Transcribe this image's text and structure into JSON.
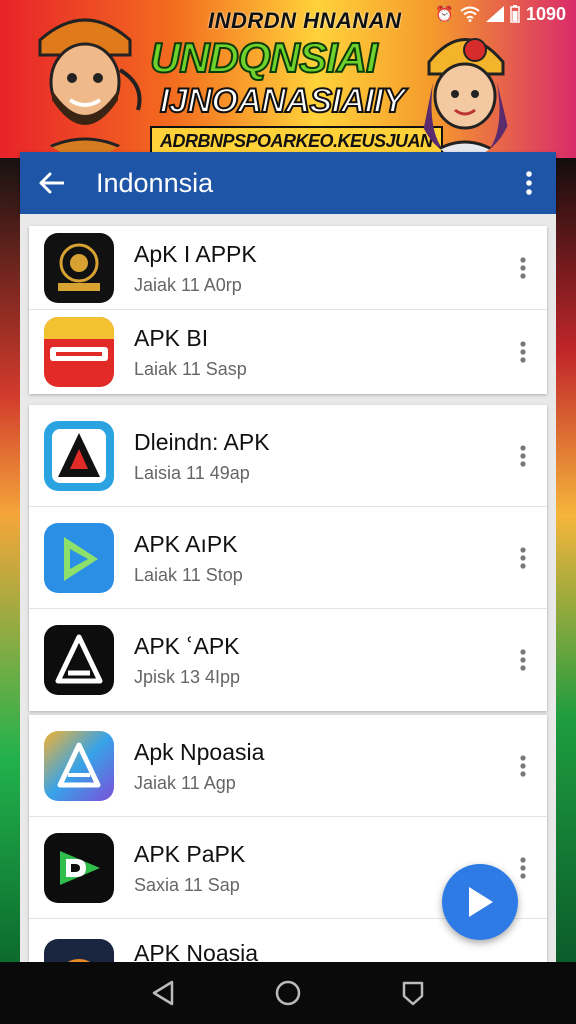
{
  "banner": {
    "line1": "INDRDN HNANAN",
    "line2": "UNDQNSIAI",
    "line3": "IJNOANASIAIIY",
    "line4": "ADRBNPSPOARKEO.KEUSJUAN"
  },
  "statusbar": {
    "time": "1090"
  },
  "appbar": {
    "title": "Indonnsia"
  },
  "list": {
    "groups": [
      {
        "items": [
          {
            "name": "ApK I APPK",
            "sub": "Jaiak 11 A0rp",
            "icon": "emblem-icon"
          },
          {
            "name": "APK BI",
            "sub": "Laiak 11 Sasp",
            "icon": "red-badge-icon"
          }
        ]
      },
      {
        "items": [
          {
            "name": "Dleindn: APK",
            "sub": "Laisia 11 49ap",
            "icon": "apk-a-logo-icon"
          },
          {
            "name": "APK AıPK",
            "sub": "Laiak 11 Stop",
            "icon": "play-triangle-icon"
          },
          {
            "name": "APK ՙAPK",
            "sub": "Jpisk 13 4Ipp",
            "icon": "a-triangle-icon"
          }
        ]
      },
      {
        "items": [
          {
            "name": "Apk Npoasia",
            "sub": "Jaiak 11 Agp",
            "icon": "gradient-a-icon"
          },
          {
            "name": "APK PaPK",
            "sub": "Saxia 11 Sap",
            "icon": "d-play-icon"
          },
          {
            "name": "APK Noasia",
            "sub": "",
            "icon": "partial-app-icon"
          }
        ]
      }
    ]
  },
  "colors": {
    "appbar": "#1f55a6",
    "fab": "#2f7be6",
    "navbar": "#0a0a0a"
  }
}
